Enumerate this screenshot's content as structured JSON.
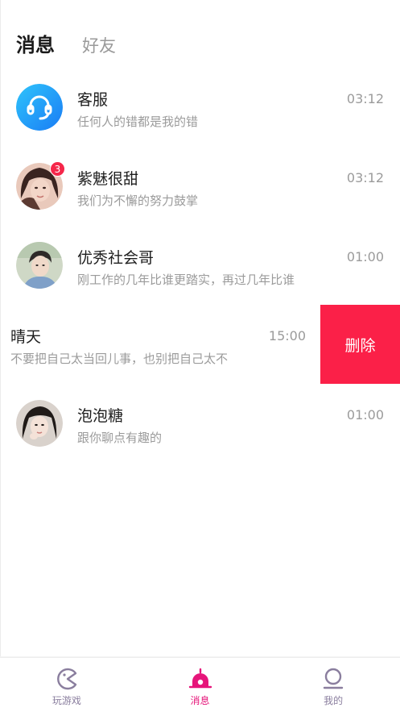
{
  "header": {
    "tab_active": "消息",
    "tab_friends": "好友"
  },
  "conversations": [
    {
      "name": "客服",
      "message": "任何人的错都是我的错",
      "time": "03:12",
      "avatar": "customer-service-icon"
    },
    {
      "name": "紫魅很甜",
      "message": "我们为不懈的努力鼓掌",
      "time": "03:12",
      "badge": "3",
      "avatar": "user-photo"
    },
    {
      "name": "优秀社会哥",
      "message": "刚工作的几年比谁更踏实，再过几年比谁",
      "time": "01:00",
      "avatar": "user-photo"
    },
    {
      "name": "晴天",
      "message": "不要把自己太当回儿事，也别把自己太不",
      "time": "15:00",
      "swiped": true
    },
    {
      "name": "泡泡糖",
      "message": "跟你聊点有趣的",
      "time": "01:00",
      "avatar": "user-photo"
    }
  ],
  "swipe_action": {
    "delete_label": "删除"
  },
  "bottom_nav": [
    {
      "label": "玩游戏",
      "icon": "game-icon",
      "active": false
    },
    {
      "label": "消息",
      "icon": "message-bell-icon",
      "active": true
    },
    {
      "label": "我的",
      "icon": "profile-icon",
      "active": false
    }
  ],
  "colors": {
    "accent": "#e6157a",
    "delete_bg": "#fb2048",
    "badge": "#f5274a",
    "inactive_nav": "#8a7e9e"
  }
}
